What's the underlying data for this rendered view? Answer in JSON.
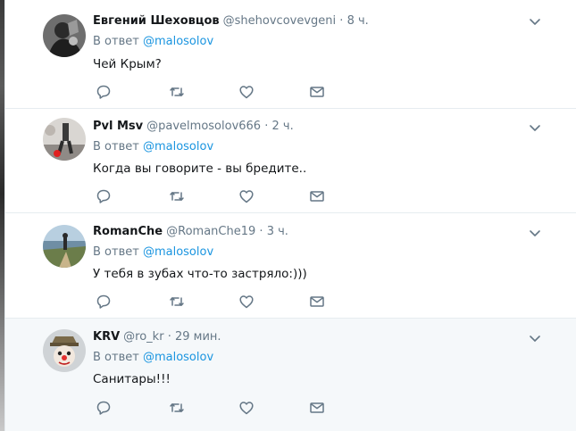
{
  "reply_prefix": "В ответ",
  "reply_to": "@malosolov",
  "dot": "·",
  "tweets": [
    {
      "fullname": "Евгений Шеховцов",
      "handle": "@shehovcovevgeni",
      "time": "8 ч.",
      "text": "Чей Крым?",
      "avatar": "avatar-dark-photo",
      "highlighted": false
    },
    {
      "fullname": "Pvl Msv",
      "handle": "@pavelmosolov666",
      "time": "2 ч.",
      "text": "Когда вы говорите - вы бредите..",
      "avatar": "avatar-soccer-photo",
      "highlighted": false
    },
    {
      "fullname": "RomanChe",
      "handle": "@RomanChe19",
      "time": "3 ч.",
      "text": "У тебя в зубах что-то застряло:)))",
      "avatar": "avatar-coast-photo",
      "highlighted": false
    },
    {
      "fullname": "KRV",
      "handle": "@ro_kr",
      "time": "29 мин.",
      "text": "Санитары!!!",
      "avatar": "avatar-clown-photo",
      "highlighted": true
    }
  ],
  "icons": {
    "caret": "chevron-down-icon",
    "reply": "reply-icon",
    "retweet": "retweet-icon",
    "like": "heart-icon",
    "dm": "envelope-icon"
  },
  "colors": {
    "accent": "#1b95e0",
    "secondary_text": "#657786",
    "icon": "#657786",
    "border": "#e6ecf0",
    "highlight_bg": "#f5f8fa"
  }
}
